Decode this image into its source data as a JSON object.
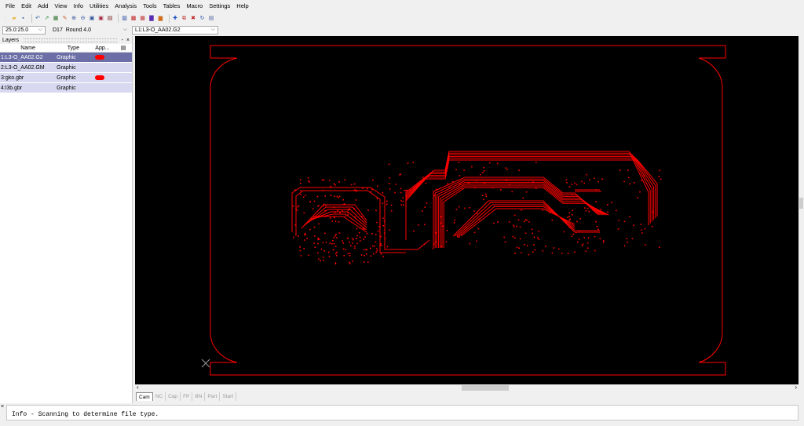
{
  "menu": [
    "File",
    "Edit",
    "Add",
    "View",
    "Info",
    "Utilities",
    "Analysis",
    "Tools",
    "Tables",
    "Macro",
    "Settings",
    "Help"
  ],
  "toolbar": {
    "buttons": [
      {
        "icon": "new-file-icon",
        "color": "#e8e8e8",
        "glyph": "▯"
      },
      {
        "icon": "open-folder-icon",
        "color": "#e6b84a",
        "glyph": "▰"
      },
      {
        "icon": "save-icon",
        "color": "#3b5b9a",
        "glyph": "▪"
      },
      {
        "icon": "undo-icon",
        "color": "#3060a0",
        "glyph": "↶"
      },
      {
        "icon": "draw-icon",
        "color": "#2a8a2a",
        "glyph": "↗"
      },
      {
        "icon": "layers-icon",
        "color": "#2b6d2b",
        "glyph": "▦"
      },
      {
        "icon": "pen-icon",
        "color": "#c85a1e",
        "glyph": "✎"
      },
      {
        "icon": "zoom-in-icon",
        "color": "#2f4f9a",
        "glyph": "⊕"
      },
      {
        "icon": "zoom-out-icon",
        "color": "#2f4f9a",
        "glyph": "⊖"
      },
      {
        "icon": "zoom-window-icon",
        "color": "#2f4f9a",
        "glyph": "▣"
      },
      {
        "icon": "zoom-fit-icon",
        "color": "#a0203a",
        "glyph": "▣"
      },
      {
        "icon": "redraw-icon",
        "color": "#7a2020",
        "glyph": "▤"
      },
      {
        "icon": "layer-view-icon",
        "color": "#2040a0",
        "glyph": "▥"
      },
      {
        "icon": "grid-icon",
        "color": "#c02020",
        "glyph": "▩"
      },
      {
        "icon": "matrix-icon",
        "color": "#c03030",
        "glyph": "▦"
      },
      {
        "icon": "colors-icon",
        "color": "#5a2ab0",
        "glyph": "▇"
      },
      {
        "icon": "palette-icon",
        "color": "#d07020",
        "glyph": "▆"
      },
      {
        "icon": "cross-icon",
        "color": "#2050c0",
        "glyph": "✚"
      },
      {
        "icon": "copy-icon",
        "color": "#c03030",
        "glyph": "⧉"
      },
      {
        "icon": "delete-icon",
        "color": "#c02020",
        "glyph": "✖"
      },
      {
        "icon": "refresh-icon",
        "color": "#2a5ab0",
        "glyph": "↻"
      },
      {
        "icon": "settings-icon",
        "color": "#5060a0",
        "glyph": "▤"
      }
    ]
  },
  "combos": {
    "zoom": "25.0:25.0",
    "dcode": "D17",
    "aperture": "Round 4.0",
    "active_layer": "L1:L3-O_AA02.G2"
  },
  "layers": {
    "title": "Layers",
    "pin": "-",
    "close": "×",
    "columns": [
      "Name",
      "Type",
      "App..."
    ],
    "rows": [
      {
        "name": "1:L3-O_AA02.G2",
        "type": "Graphic",
        "swatch": "#ff0000",
        "selected": true
      },
      {
        "name": "2:L3-O_AA02.GM",
        "type": "Graphic",
        "swatch": "",
        "selected": false
      },
      {
        "name": "3:gko.gbr",
        "type": "Graphic",
        "swatch": "#ff0000",
        "selected": false
      },
      {
        "name": "4:l3b.gbr",
        "type": "Graphic",
        "swatch": "",
        "selected": false
      }
    ]
  },
  "tabs": [
    "Cam",
    "NC",
    "Cap",
    "FP",
    "BN",
    "Part",
    "Start"
  ],
  "active_tab": "Cam",
  "message": "Info - Scanning to determine file type.",
  "colors": {
    "canvas": "#000000",
    "trace": "#ff0000",
    "selected_row": "#6b6fa6",
    "row": "#d8d8f0"
  }
}
